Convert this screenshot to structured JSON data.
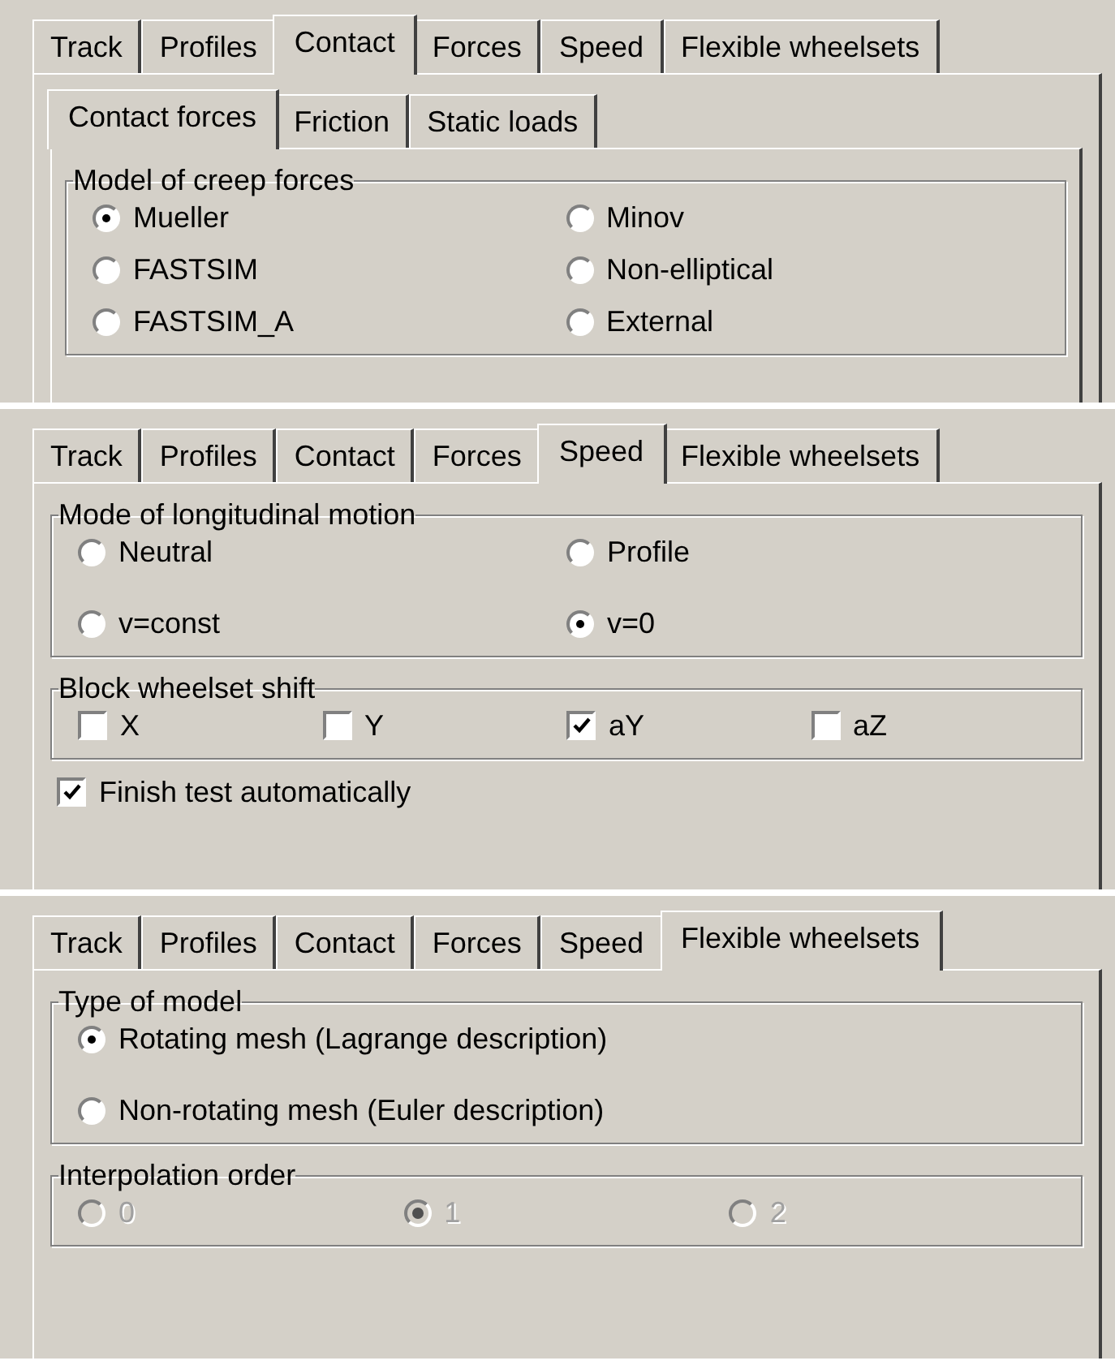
{
  "panels": [
    {
      "tabs": [
        {
          "label": "Track",
          "selected": false
        },
        {
          "label": "Profiles",
          "selected": false
        },
        {
          "label": "Contact",
          "selected": true
        },
        {
          "label": "Forces",
          "selected": false
        },
        {
          "label": "Speed",
          "selected": false
        },
        {
          "label": "Flexible wheelsets",
          "selected": false
        }
      ],
      "subtabs": [
        {
          "label": "Contact forces",
          "selected": true
        },
        {
          "label": "Friction",
          "selected": false
        },
        {
          "label": "Static loads",
          "selected": false
        }
      ],
      "groups": [
        {
          "title": "Model of creep forces",
          "disabled": false,
          "rows": [
            [
              {
                "kind": "radio",
                "label": "Mueller",
                "selected": true
              },
              {
                "kind": "radio",
                "label": "Minov",
                "selected": false
              }
            ],
            [
              {
                "kind": "radio",
                "label": "FASTSIM",
                "selected": false
              },
              {
                "kind": "radio",
                "label": "Non-elliptical",
                "selected": false
              }
            ],
            [
              {
                "kind": "radio",
                "label": "FASTSIM_A",
                "selected": false
              },
              {
                "kind": "radio",
                "label": "External",
                "selected": false
              }
            ]
          ]
        }
      ]
    },
    {
      "tabs": [
        {
          "label": "Track",
          "selected": false
        },
        {
          "label": "Profiles",
          "selected": false
        },
        {
          "label": "Contact",
          "selected": false
        },
        {
          "label": "Forces",
          "selected": false
        },
        {
          "label": "Speed",
          "selected": true
        },
        {
          "label": "Flexible wheelsets",
          "selected": false
        }
      ],
      "groups": [
        {
          "title": "Mode of longitudinal motion",
          "disabled": false,
          "rows": [
            [
              {
                "kind": "radio",
                "label": "Neutral",
                "selected": false
              },
              {
                "kind": "radio",
                "label": "Profile",
                "selected": false
              }
            ],
            [
              {
                "kind": "radio",
                "label": "v=const",
                "selected": false
              },
              {
                "kind": "radio",
                "label": "v=0",
                "selected": true
              }
            ]
          ]
        },
        {
          "title": "Block wheelset shift",
          "disabled": false,
          "rows": [
            [
              {
                "kind": "checkbox",
                "label": "X",
                "checked": false
              },
              {
                "kind": "checkbox",
                "label": "Y",
                "checked": false
              },
              {
                "kind": "checkbox",
                "label": "aY",
                "checked": true
              },
              {
                "kind": "checkbox",
                "label": "aZ",
                "checked": false
              }
            ]
          ]
        }
      ],
      "options": [
        {
          "kind": "checkbox",
          "label": "Finish test automatically",
          "checked": true
        }
      ]
    },
    {
      "tabs": [
        {
          "label": "Track",
          "selected": false
        },
        {
          "label": "Profiles",
          "selected": false
        },
        {
          "label": "Contact",
          "selected": false
        },
        {
          "label": "Forces",
          "selected": false
        },
        {
          "label": "Speed",
          "selected": false
        },
        {
          "label": "Flexible wheelsets",
          "selected": true
        }
      ],
      "groups": [
        {
          "title": "Type of model",
          "disabled": false,
          "rows": [
            [
              {
                "kind": "radio",
                "label": "Rotating mesh (Lagrange description)",
                "selected": true
              }
            ],
            [
              {
                "kind": "radio",
                "label": "Non-rotating mesh (Euler description)",
                "selected": false
              }
            ]
          ]
        },
        {
          "title": "Interpolation order",
          "disabled": true,
          "rows": [
            [
              {
                "kind": "radio",
                "label": "0",
                "selected": false
              },
              {
                "kind": "radio",
                "label": "1",
                "selected": true
              },
              {
                "kind": "radio",
                "label": "2",
                "selected": false
              }
            ]
          ]
        }
      ]
    }
  ]
}
